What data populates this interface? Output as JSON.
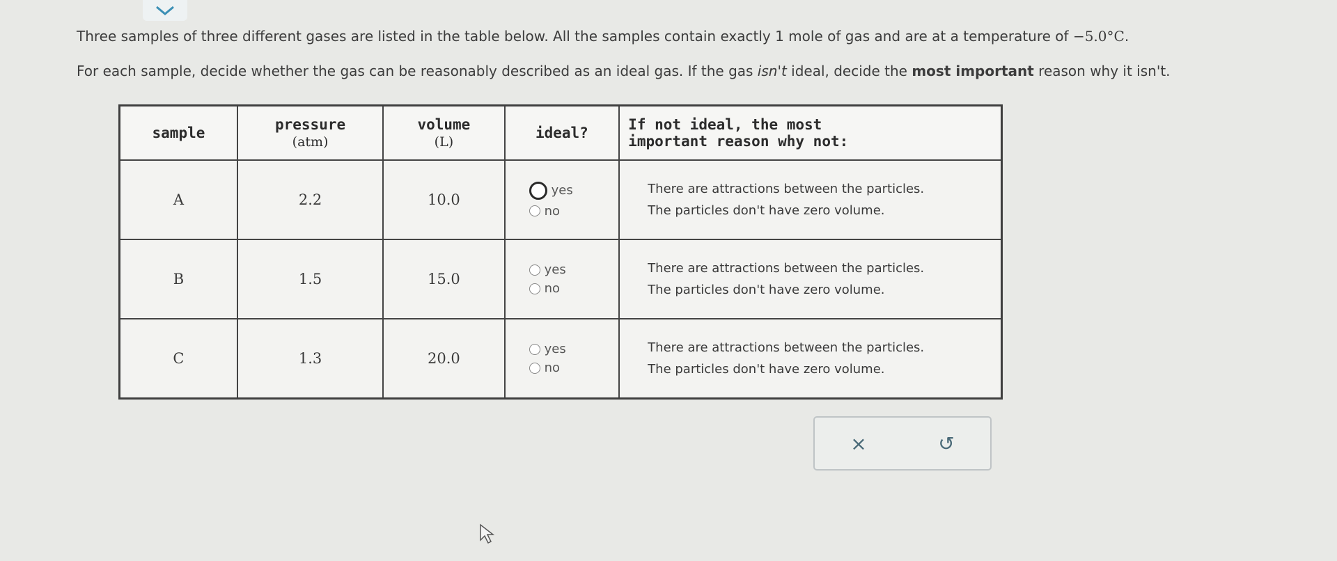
{
  "prompt": {
    "line1": "Three samples of three different gases are listed in the table below. All the samples contain exactly 1 mole of gas and are at a temperature of ",
    "temperature": "−5.0°C",
    "line1_end": ".",
    "line2_part1": "For each sample, decide whether the gas can be reasonably described as an ideal gas. If the gas ",
    "line2_em": "isn't",
    "line2_part2": " ideal, decide the ",
    "line2_bold": "most important",
    "line2_part3": " reason why it isn't."
  },
  "table": {
    "headers": {
      "sample": "sample",
      "pressure": "pressure",
      "pressure_unit": "(atm)",
      "volume": "volume",
      "volume_unit": "(L)",
      "ideal": "ideal?",
      "reason_line1": "If not ideal, the most",
      "reason_line2": "important reason why not:"
    },
    "rows": [
      {
        "sample": "A",
        "pressure": "2.2",
        "volume": "10.0",
        "yes": "yes",
        "no": "no",
        "reason1": "There are attractions between the particles.",
        "reason2": "The particles don't have zero volume."
      },
      {
        "sample": "B",
        "pressure": "1.5",
        "volume": "15.0",
        "yes": "yes",
        "no": "no",
        "reason1": "There are attractions between the particles.",
        "reason2": "The particles don't have zero volume."
      },
      {
        "sample": "C",
        "pressure": "1.3",
        "volume": "20.0",
        "yes": "yes",
        "no": "no",
        "reason1": "There are attractions between the particles.",
        "reason2": "The particles don't have zero volume."
      }
    ]
  },
  "actions": {
    "clear": "×",
    "undo": "↺"
  },
  "colors": {
    "accent": "#3b8fb5",
    "border": "#444444"
  }
}
